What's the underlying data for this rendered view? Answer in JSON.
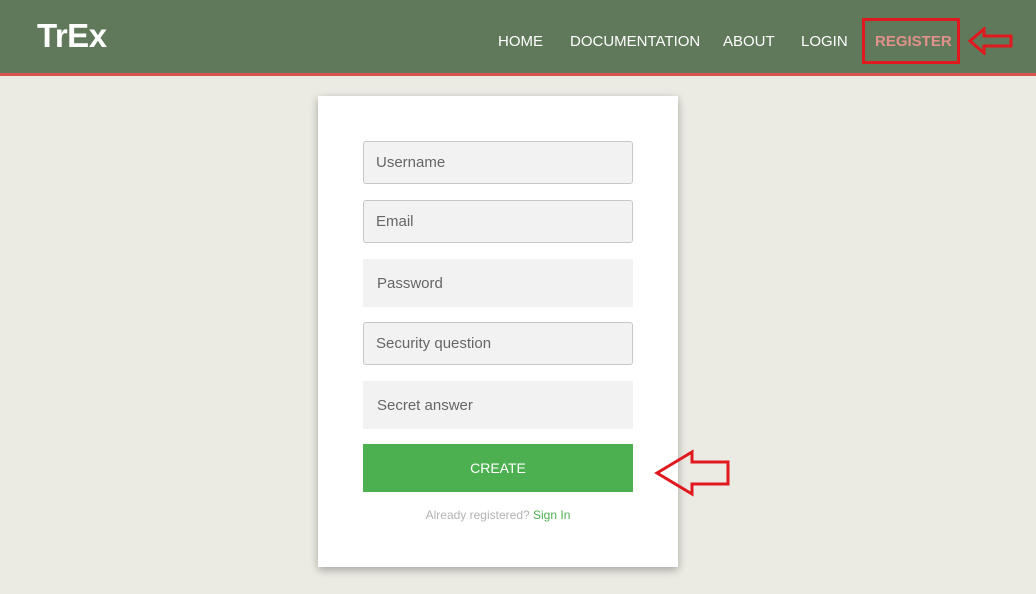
{
  "navbar": {
    "brand": "TrEx",
    "links": {
      "home": "HOME",
      "documentation": "DOCUMENTATION",
      "about": "ABOUT",
      "login": "LOGIN",
      "register": "REGISTER"
    }
  },
  "form": {
    "username_placeholder": "Username",
    "email_placeholder": "Email",
    "password_placeholder": "Password",
    "security_question_placeholder": "Security question",
    "secret_answer_placeholder": "Secret answer",
    "create_label": "CREATE",
    "already_registered_text": "Already registered?",
    "sign_in_label": "Sign In"
  },
  "colors": {
    "navbar": "#61795b",
    "navbar_border": "#d9534f",
    "register_link": "#e0928a",
    "primary_green": "#4caf50",
    "annotation_red": "#e0191f",
    "page_background": "#ebebe3"
  },
  "annotations": {
    "arrow_icons": [
      "arrow-left-outline-icon",
      "arrow-left-outline-icon"
    ]
  }
}
